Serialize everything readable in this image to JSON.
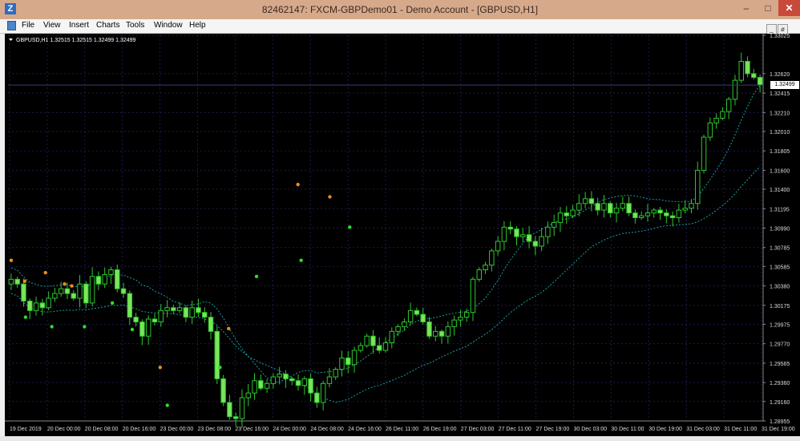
{
  "window": {
    "app_icon": "Z",
    "title": "82462147: FXCM-GBPDemo01 - Demo Account - [GBPUSD,H1]",
    "minimize_icon": "–",
    "maximize_icon": "□",
    "close_icon": "✕"
  },
  "menu": {
    "items": [
      "File",
      "View",
      "Insert",
      "Charts",
      "Tools",
      "Window",
      "Help"
    ]
  },
  "mdi_buttons": [
    "_",
    "ø",
    "x"
  ],
  "chart_data": {
    "type": "candlestick",
    "symbol_header": "GBPUSD,H1  1.32515 1.32515 1.32499 1.32499",
    "current_price_label": "1.32499",
    "y_ticks": [
      "1.33025",
      "1.32620",
      "1.32415",
      "1.32210",
      "1.32010",
      "1.31805",
      "1.31600",
      "1.31400",
      "1.31195",
      "1.30990",
      "1.30785",
      "1.30585",
      "1.30380",
      "1.30175",
      "1.29975",
      "1.29770",
      "1.29565",
      "1.29360",
      "1.29160",
      "1.28955"
    ],
    "ylim": [
      1.28955,
      1.33025
    ],
    "x_ticks": [
      "19 Dec 2019",
      "20 Dec 00:00",
      "20 Dec 08:00",
      "20 Dec 16:00",
      "23 Dec 00:00",
      "23 Dec 08:00",
      "23 Dec 16:00",
      "24 Dec 00:00",
      "24 Dec 08:00",
      "24 Dec 16:00",
      "26 Dec 11:00",
      "26 Dec 19:00",
      "27 Dec 03:00",
      "27 Dec 11:00",
      "27 Dec 19:00",
      "30 Dec 03:00",
      "30 Dec 11:00",
      "30 Dec 19:00",
      "31 Dec 03:00",
      "31 Dec 11:00",
      "31 Dec 19:00"
    ],
    "close_path": [
      1.3045,
      1.304,
      1.3022,
      1.3012,
      1.302,
      1.3015,
      1.3025,
      1.303,
      1.3035,
      1.303,
      1.3025,
      1.304,
      1.302,
      1.3048,
      1.304,
      1.305,
      1.3055,
      1.3035,
      1.303,
      1.3005,
      1.3,
      1.2985,
      1.3003,
      1.3,
      1.3012,
      1.3015,
      1.3012,
      1.3015,
      1.3005,
      1.3015,
      1.301,
      1.3005,
      1.299,
      1.294,
      1.2915,
      1.29,
      1.2898,
      1.292,
      1.2925,
      1.2938,
      1.293,
      1.2935,
      1.2942,
      1.2945,
      1.294,
      1.2938,
      1.2933,
      1.294,
      1.2925,
      1.2915,
      1.2935,
      1.2942,
      1.295,
      1.2962,
      1.2955,
      1.297,
      1.2975,
      1.2985,
      1.2975,
      1.297,
      1.2978,
      1.299,
      1.2995,
      1.3,
      1.3012,
      1.3008,
      1.3,
      1.2985,
      1.299,
      1.2985,
      1.2995,
      1.3002,
      1.3005,
      1.301,
      1.3045,
      1.3055,
      1.306,
      1.3075,
      1.3085,
      1.31,
      1.3098,
      1.309,
      1.3092,
      1.3085,
      1.308,
      1.309,
      1.31,
      1.3105,
      1.3115,
      1.3112,
      1.3118,
      1.3125,
      1.313,
      1.3125,
      1.3118,
      1.3125,
      1.3115,
      1.312,
      1.3125,
      1.3115,
      1.311,
      1.3112,
      1.3115,
      1.3118,
      1.3115,
      1.3112,
      1.311,
      1.3118,
      1.312,
      1.3125,
      1.316,
      1.3195,
      1.321,
      1.3215,
      1.3222,
      1.3235,
      1.3255,
      1.3275,
      1.3262,
      1.3258,
      1.325
    ],
    "orange_dots": [
      [
        4,
        1.3065
      ],
      [
        21,
        1.3043
      ],
      [
        47,
        1.3052
      ],
      [
        71,
        1.304
      ],
      [
        80,
        1.3038
      ],
      [
        191,
        1.2952
      ],
      [
        277,
        1.2993
      ],
      [
        364,
        1.3145
      ],
      [
        404,
        1.3132
      ]
    ],
    "green_dots": [
      [
        22,
        1.3005
      ],
      [
        55,
        1.2995
      ],
      [
        96,
        1.2995
      ],
      [
        131,
        1.302
      ],
      [
        156,
        1.2992
      ],
      [
        200,
        1.2912
      ],
      [
        266,
        1.2952
      ],
      [
        312,
        1.3048
      ],
      [
        368,
        1.3065
      ],
      [
        429,
        1.31
      ]
    ]
  }
}
